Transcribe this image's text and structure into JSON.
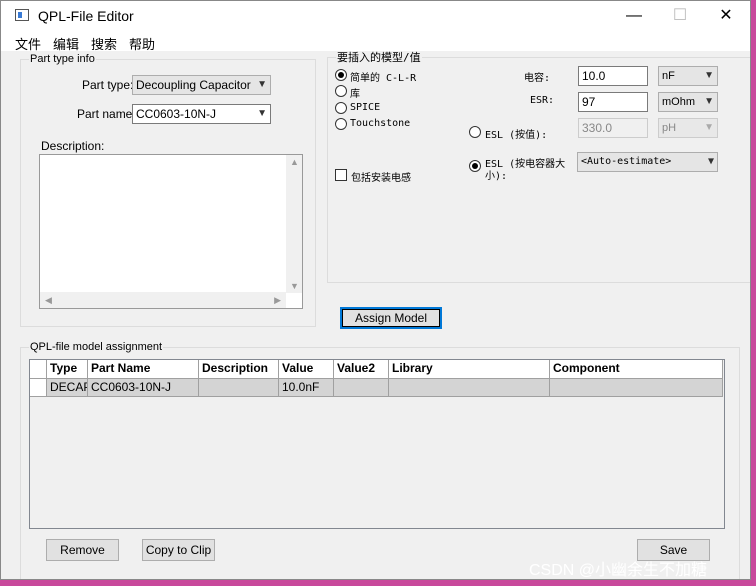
{
  "window": {
    "title": "QPL-File Editor",
    "min_glyph": "—",
    "max_glyph": "☐",
    "close_glyph": "✕"
  },
  "menu": [
    "文件",
    "编辑",
    "搜索",
    "帮助"
  ],
  "part_type_info": {
    "legend": "Part type info",
    "part_type_label": "Part type:",
    "part_type_value": "Decoupling Capacitor",
    "part_name_label": "Part name:",
    "part_name_value": "CC0603-10N-J",
    "description_label": "Description:",
    "description_value": ""
  },
  "model": {
    "legend": "要插入的模型/值",
    "options": [
      "简单的 C-L-R",
      "库",
      "SPICE",
      "Touchstone"
    ],
    "selected_index": 0,
    "include_mount_inductance_label": "包括安装电感",
    "include_mount_inductance_checked": false,
    "capacitance_label": "电容:",
    "capacitance_value": "10.0",
    "capacitance_unit": "nF",
    "esr_label": "ESR:",
    "esr_value": "97",
    "esr_unit": "mOhm",
    "esl_value_label": "ESL (按值):",
    "esl_value": "330.0",
    "esl_unit": "pH",
    "esl_by_size_label_line1": "ESL (按电容器大",
    "esl_by_size_label_line2": "小):",
    "esl_by_size_value": "<Auto-estimate>",
    "esl_selected": "by_size"
  },
  "assign_model_button": "Assign Model",
  "assignment": {
    "legend": "QPL-file model assignment",
    "columns": [
      "Type",
      "Part Name",
      "Description",
      "Value",
      "Value2",
      "Library",
      "Component"
    ],
    "rows": [
      [
        "DECAP",
        "CC0603-10N-J",
        "",
        "10.0nF",
        "",
        "",
        ""
      ]
    ]
  },
  "buttons": {
    "remove": "Remove",
    "copy_to_clip": "Copy to Clip",
    "save": "Save"
  },
  "watermark": "CSDN @小幽余生不加糖",
  "colors": {
    "desktop": "#c8499b",
    "focus": "#0078d7",
    "selected_row": "#d4d4d4"
  }
}
